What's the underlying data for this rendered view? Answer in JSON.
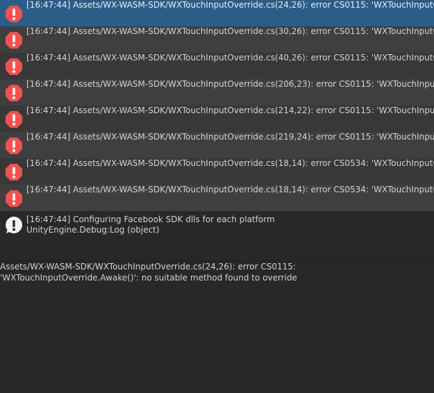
{
  "console": {
    "entries": [
      {
        "type": "error",
        "icon": "error-icon",
        "text": "[16:47:44] Assets/WX-WASM-SDK/WXTouchInputOverride.cs(24,26): error CS0115: 'WXTouchInputOverride.Awake()': no suitable method found to override",
        "selected": true
      },
      {
        "type": "error",
        "icon": "error-icon",
        "text": "[16:47:44] Assets/WX-WASM-SDK/WXTouchInputOverride.cs(30,26): error CS0115: 'WXTouchInputOverride.OnEnable()': no suitable method found to override"
      },
      {
        "type": "error",
        "icon": "error-icon",
        "text": "[16:47:44] Assets/WX-WASM-SDK/WXTouchInputOverride.cs(40,26): error CS0115: 'WXTouchInputOverride.OnDisable()': no suitable method found to override"
      },
      {
        "type": "error",
        "icon": "error-icon",
        "text": "[16:47:44] Assets/WX-WASM-SDK/WXTouchInputOverride.cs(206,23): error CS0115: 'WXTouchInputOverride.GetTouch(int)': no suitable method found to override"
      },
      {
        "type": "error",
        "icon": "error-icon",
        "text": "[16:47:44] Assets/WX-WASM-SDK/WXTouchInputOverride.cs(214,22): error CS0115: 'WXTouchInputOverride.touchCount': no suitable method found to override"
      },
      {
        "type": "error",
        "icon": "error-icon",
        "text": "[16:47:44] Assets/WX-WASM-SDK/WXTouchInputOverride.cs(219,24): error CS0115: 'WXTouchInputOverride.touchSupported': no suitable method found to override"
      },
      {
        "type": "error",
        "icon": "error-icon",
        "text": "[16:47:44] Assets/WX-WASM-SDK/WXTouchInputOverride.cs(18,14): error CS0534: 'WXTouchInputOverride' does not implement inherited abstract member"
      },
      {
        "type": "error",
        "icon": "error-icon",
        "text": "[16:47:44] Assets/WX-WASM-SDK/WXTouchInputOverride.cs(18,14): error CS0534: 'WXTouchInputOverride' does not implement inherited abstract member"
      }
    ],
    "info_entry": {
      "type": "log",
      "icon": "info-icon",
      "line1": "[16:47:44] Configuring Facebook SDK dlls for each platform",
      "line2": "UnityEngine.Debug:Log (object)"
    },
    "detail_text": "Assets/WX-WASM-SDK/WXTouchInputOverride.cs(24,26): error CS0115: 'WXTouchInputOverride.Awake()': no suitable method found to override"
  },
  "colors": {
    "background": "#282828",
    "row_even": "#383838",
    "row_odd": "#3f3f3f",
    "row_selected": "#2c5d87",
    "error_red": "#f05252",
    "text": "#d2d2d2"
  }
}
